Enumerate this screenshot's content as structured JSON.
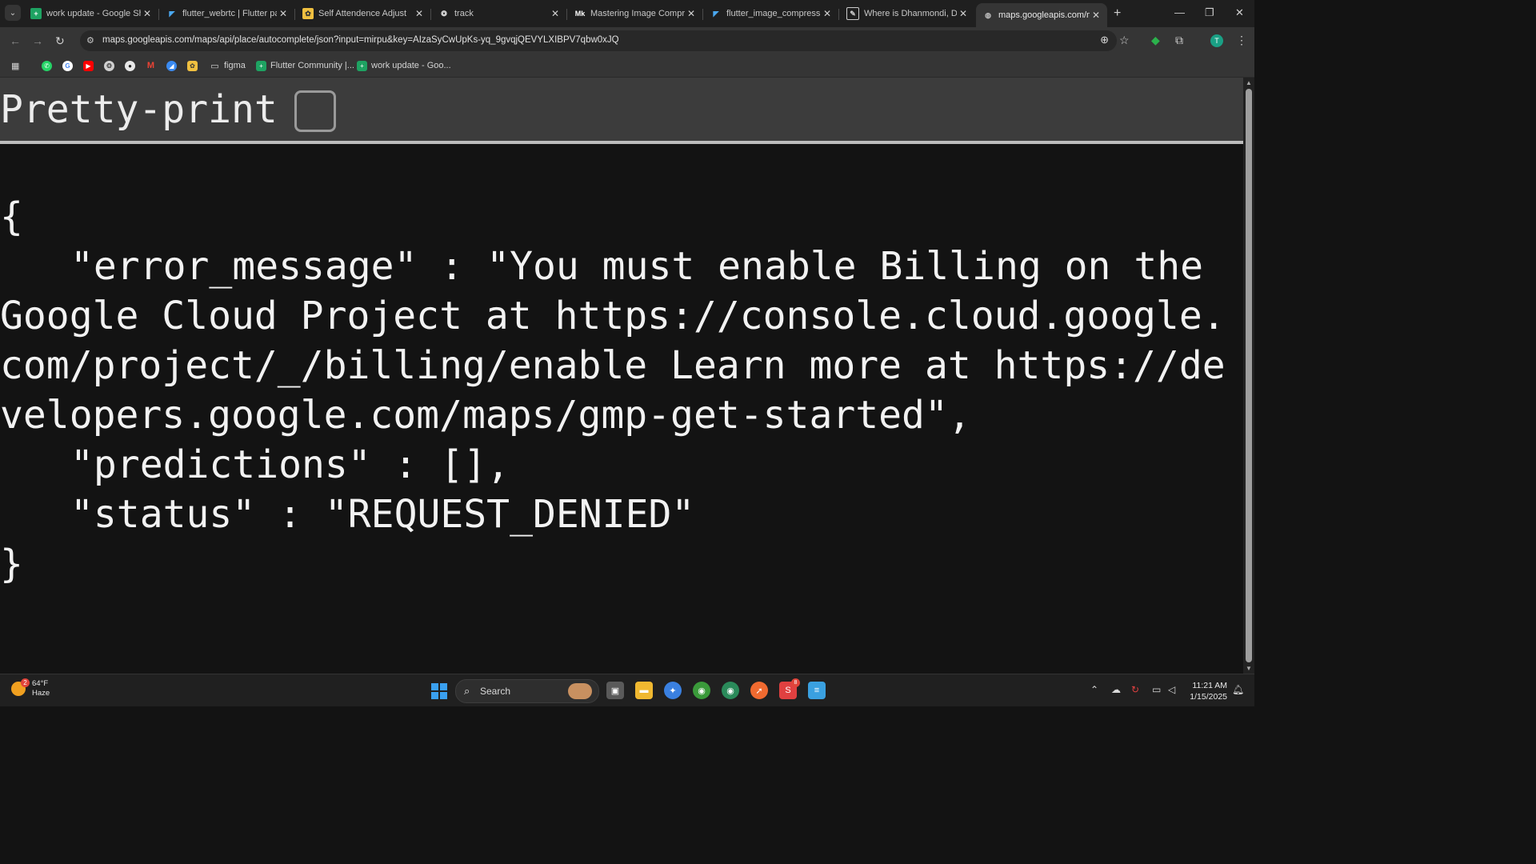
{
  "browser": {
    "tabs": [
      {
        "title": "work update - Google Sh",
        "icon": "sheets-icon",
        "color": "#1ea362"
      },
      {
        "title": "flutter_webrtc | Flutter pa",
        "icon": "flutter-icon",
        "color": "#4aa8f0"
      },
      {
        "title": "Self Attendence Adjust",
        "icon": "app-icon",
        "color": "#f0c040"
      },
      {
        "title": "track",
        "icon": "openai-icon",
        "color": "#e0e0e0"
      },
      {
        "title": "Mastering Image Compre",
        "icon": "medium-icon",
        "color": "#ffffff"
      },
      {
        "title": "flutter_image_compress |",
        "icon": "flutter-icon",
        "color": "#4aa8f0"
      },
      {
        "title": "Where is Dhanmondi, Dh",
        "icon": "page-icon",
        "color": "#e0e0e0"
      },
      {
        "title": "maps.googleapis.com/ma",
        "icon": "globe-icon",
        "color": "#c0c0c0",
        "active": true
      }
    ],
    "url": "maps.googleapis.com/maps/api/place/autocomplete/json?input=mirpu&key=AIzaSyCwUpKs-yq_9gvqjQEVYLXIBPV7qbw0xJQ",
    "avatar_letter": "T",
    "bookmarks": [
      {
        "label": "",
        "icon": "whatsapp-icon",
        "color": "#25d366"
      },
      {
        "label": "",
        "icon": "google-icon",
        "color": "#e8e8e8"
      },
      {
        "label": "",
        "icon": "youtube-icon",
        "color": "#ff0000"
      },
      {
        "label": "",
        "icon": "chatgpt-icon",
        "color": "#d0d0d0"
      },
      {
        "label": "",
        "icon": "github-icon",
        "color": "#e8e8e8"
      },
      {
        "label": "",
        "icon": "gmail-icon",
        "color": "#ea4335"
      },
      {
        "label": "",
        "icon": "bookmark-app-icon",
        "color": "#3a8af0"
      },
      {
        "label": "",
        "icon": "photos-icon",
        "color": "#f0c040"
      },
      {
        "label": "figma",
        "icon": "folder-icon",
        "color": "#d4d4d4"
      },
      {
        "label": "Flutter Community |...",
        "icon": "sheets-icon",
        "color": "#1ea362"
      },
      {
        "label": "work update - Goo...",
        "icon": "sheets-icon",
        "color": "#1ea362"
      }
    ]
  },
  "page": {
    "pretty_print_label": "Pretty-print",
    "pretty_print_checked": false,
    "json_lines": [
      "{",
      "\"error_message\" : \"You must enable Billing on the Google Cloud Project at https://console.cloud.google.com/project/_/billing/enable Learn more at https://developers.google.com/maps/gmp-get-started\",",
      "\"predictions\" : [],",
      "\"status\" : \"REQUEST_DENIED\"",
      "}"
    ]
  },
  "taskbar": {
    "weather_temp": "64°F",
    "weather_desc": "Haze",
    "weather_badge": "2",
    "search_label": "Search",
    "time": "11:21 AM",
    "date": "1/15/2025",
    "apps": [
      {
        "icon": "task-view-icon",
        "color": "#5a5a5a"
      },
      {
        "icon": "file-explorer-icon",
        "color": "#f0b830"
      },
      {
        "icon": "app-store-icon",
        "color": "#3a80e0"
      },
      {
        "icon": "chrome-icon",
        "color": "#3a9a3a"
      },
      {
        "icon": "chrome-profile-icon",
        "color": "#2a8a5a"
      },
      {
        "icon": "postman-icon",
        "color": "#f06a30"
      },
      {
        "icon": "skype-icon",
        "color": "#e04040"
      },
      {
        "icon": "notepad-icon",
        "color": "#3aa0e0"
      }
    ],
    "skype_badge": "8"
  }
}
